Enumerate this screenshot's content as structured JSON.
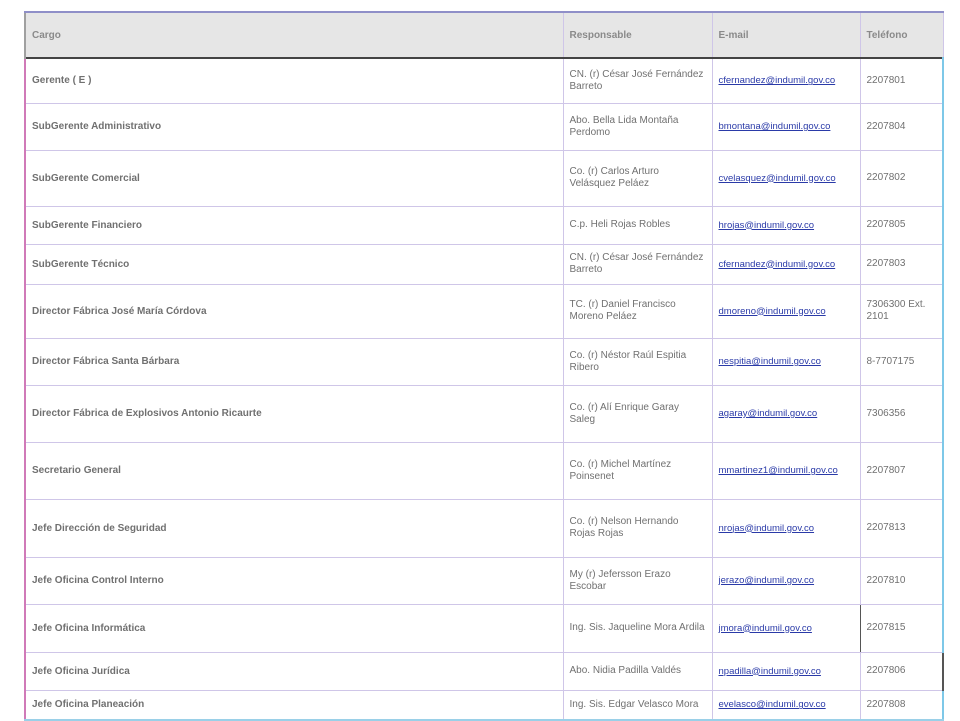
{
  "table": {
    "headers": {
      "cargo": "Cargo",
      "responsable": "Responsable",
      "email": "E-mail",
      "telefono": "Teléfono"
    },
    "rows": [
      {
        "cargo": "Gerente ( E )",
        "responsable": "CN. (r) César José Fernández Barreto",
        "email": "cfernandez@indumil.gov.co",
        "telefono": "2207801"
      },
      {
        "cargo": "SubGerente Administrativo",
        "responsable": "Abo. Bella Lida Montaña Perdomo",
        "email": "bmontana@indumil.gov.co",
        "telefono": "2207804"
      },
      {
        "cargo": "SubGerente Comercial",
        "responsable": "Co. (r) Carlos Arturo Velásquez Peláez",
        "email": "cvelasquez@indumil.gov.co",
        "telefono": "2207802"
      },
      {
        "cargo": "SubGerente Financiero",
        "responsable": "C.p. Heli Rojas Robles",
        "email": "hrojas@indumil.gov.co",
        "telefono": "2207805"
      },
      {
        "cargo": "SubGerente Técnico",
        "responsable": "CN. (r) César José Fernández Barreto",
        "email": "cfernandez@indumil.gov.co",
        "telefono": "2207803"
      },
      {
        "cargo": "Director Fábrica José María Córdova",
        "responsable": "TC. (r) Daniel Francisco Moreno Peláez",
        "email": "dmoreno@indumil.gov.co",
        "telefono": "7306300 Ext. 2101"
      },
      {
        "cargo": "Director Fábrica Santa Bárbara",
        "responsable": "Co. (r) Néstor Raúl Espitia Ribero",
        "email": "nespitia@indumil.gov.co",
        "telefono": "8-7707175"
      },
      {
        "cargo": "Director Fábrica de Explosivos Antonio Ricaurte",
        "responsable": "Co. (r) Alí Enrique Garay Saleg",
        "email": "agaray@indumil.gov.co",
        "telefono": "7306356"
      },
      {
        "cargo": "Secretario General",
        "responsable": "Co. (r) Michel Martínez Poinsenet",
        "email": "mmartinez1@indumil.gov.co",
        "telefono": "2207807"
      },
      {
        "cargo": "Jefe Dirección de Seguridad",
        "responsable": "Co. (r) Nelson Hernando Rojas Rojas",
        "email": "nrojas@indumil.gov.co",
        "telefono": "2207813"
      },
      {
        "cargo": "Jefe Oficina Control Interno",
        "responsable": "My (r) Jefersson Erazo Escobar",
        "email": "jerazo@indumil.gov.co",
        "telefono": "2207810"
      },
      {
        "cargo": "Jefe Oficina Informática",
        "responsable": "Ing. Sis. Jaqueline Mora Ardila",
        "email": "jmora@indumil.gov.co",
        "telefono": "2207815"
      },
      {
        "cargo": "Jefe Oficina Jurídica",
        "responsable": "Abo. Nidia Padilla Valdés",
        "email": "npadilla@indumil.gov.co",
        "telefono": "2207806"
      },
      {
        "cargo": "Jefe Oficina Planeación",
        "responsable": "Ing. Sis. Edgar Velasco Mora",
        "email": "evelasco@indumil.gov.co",
        "telefono": "2207808"
      }
    ]
  }
}
